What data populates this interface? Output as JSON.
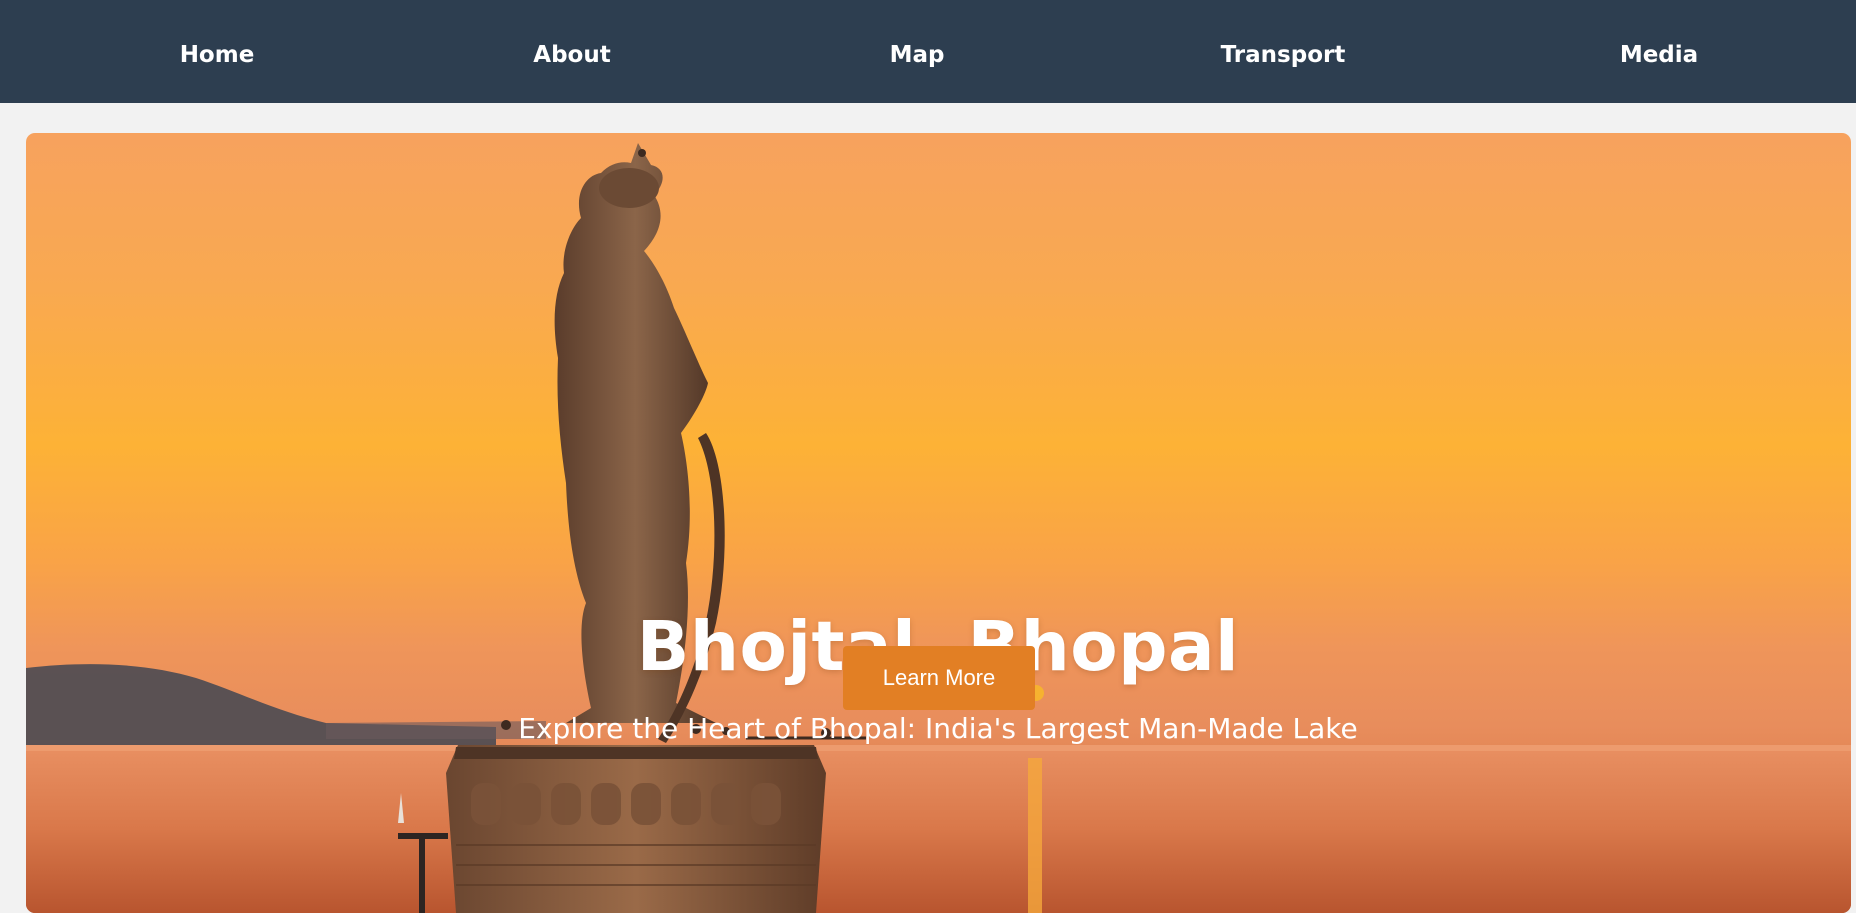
{
  "nav": {
    "items": [
      {
        "label": "Home"
      },
      {
        "label": "About"
      },
      {
        "label": "Map"
      },
      {
        "label": "Transport"
      },
      {
        "label": "Media"
      }
    ]
  },
  "hero": {
    "title": "Bhojtal, Bhopal",
    "subtitle": "Explore the Heart of Bhopal: India's Largest Man-Made Lake",
    "button_label": "Learn More",
    "colors": {
      "navbar_bg": "#2d3e50",
      "button_bg": "#e27f24",
      "sky_orange": "#fdb236"
    }
  }
}
